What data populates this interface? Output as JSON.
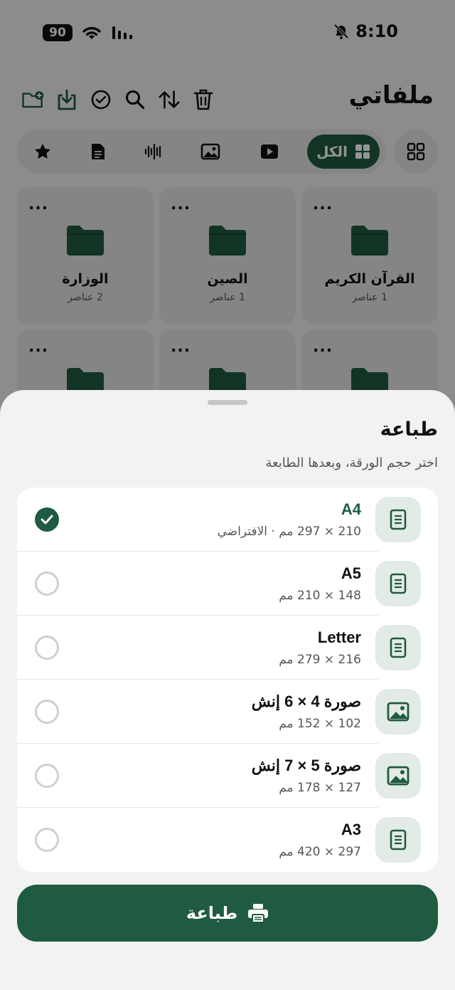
{
  "status": {
    "battery": "90",
    "time": "8:10"
  },
  "header": {
    "title": "ملفاتي"
  },
  "toolbar": [
    "new-folder-icon",
    "download-icon",
    "select-icon",
    "search-icon",
    "sort-icon",
    "trash-icon"
  ],
  "filters": {
    "all_label": "الكل"
  },
  "folders": [
    {
      "name": "القرآن الكريم",
      "count": "1 عناصر"
    },
    {
      "name": "الصين",
      "count": "1 عناصر"
    },
    {
      "name": "الوزارة",
      "count": "2 عناصر"
    }
  ],
  "folder_menu": "...",
  "sheet": {
    "title": "طباعة",
    "subtitle": "اختر حجم الورقة، وبعدها الطابعة",
    "options": [
      {
        "title": "A4",
        "subtitle": "210 × 297 مم · الافتراضي",
        "icon": "document-icon",
        "selected": true
      },
      {
        "title": "A5",
        "subtitle": "148 × 210 مم",
        "icon": "document-icon",
        "selected": false
      },
      {
        "title": "Letter",
        "subtitle": "216 × 279 مم",
        "icon": "document-icon",
        "selected": false
      },
      {
        "title": "صورة 4 × 6 إنش",
        "subtitle": "102 × 152 مم",
        "icon": "image-icon",
        "selected": false
      },
      {
        "title": "صورة 5 × 7 إنش",
        "subtitle": "127 × 178 مم",
        "icon": "image-icon",
        "selected": false
      },
      {
        "title": "A3",
        "subtitle": "297 × 420 مم",
        "icon": "document-icon",
        "selected": false
      }
    ],
    "print_label": "طباعة"
  },
  "colors": {
    "accent": "#1f5b40",
    "accent_light": "#e3ebe7",
    "sheet_bg": "#f2f2f2"
  }
}
